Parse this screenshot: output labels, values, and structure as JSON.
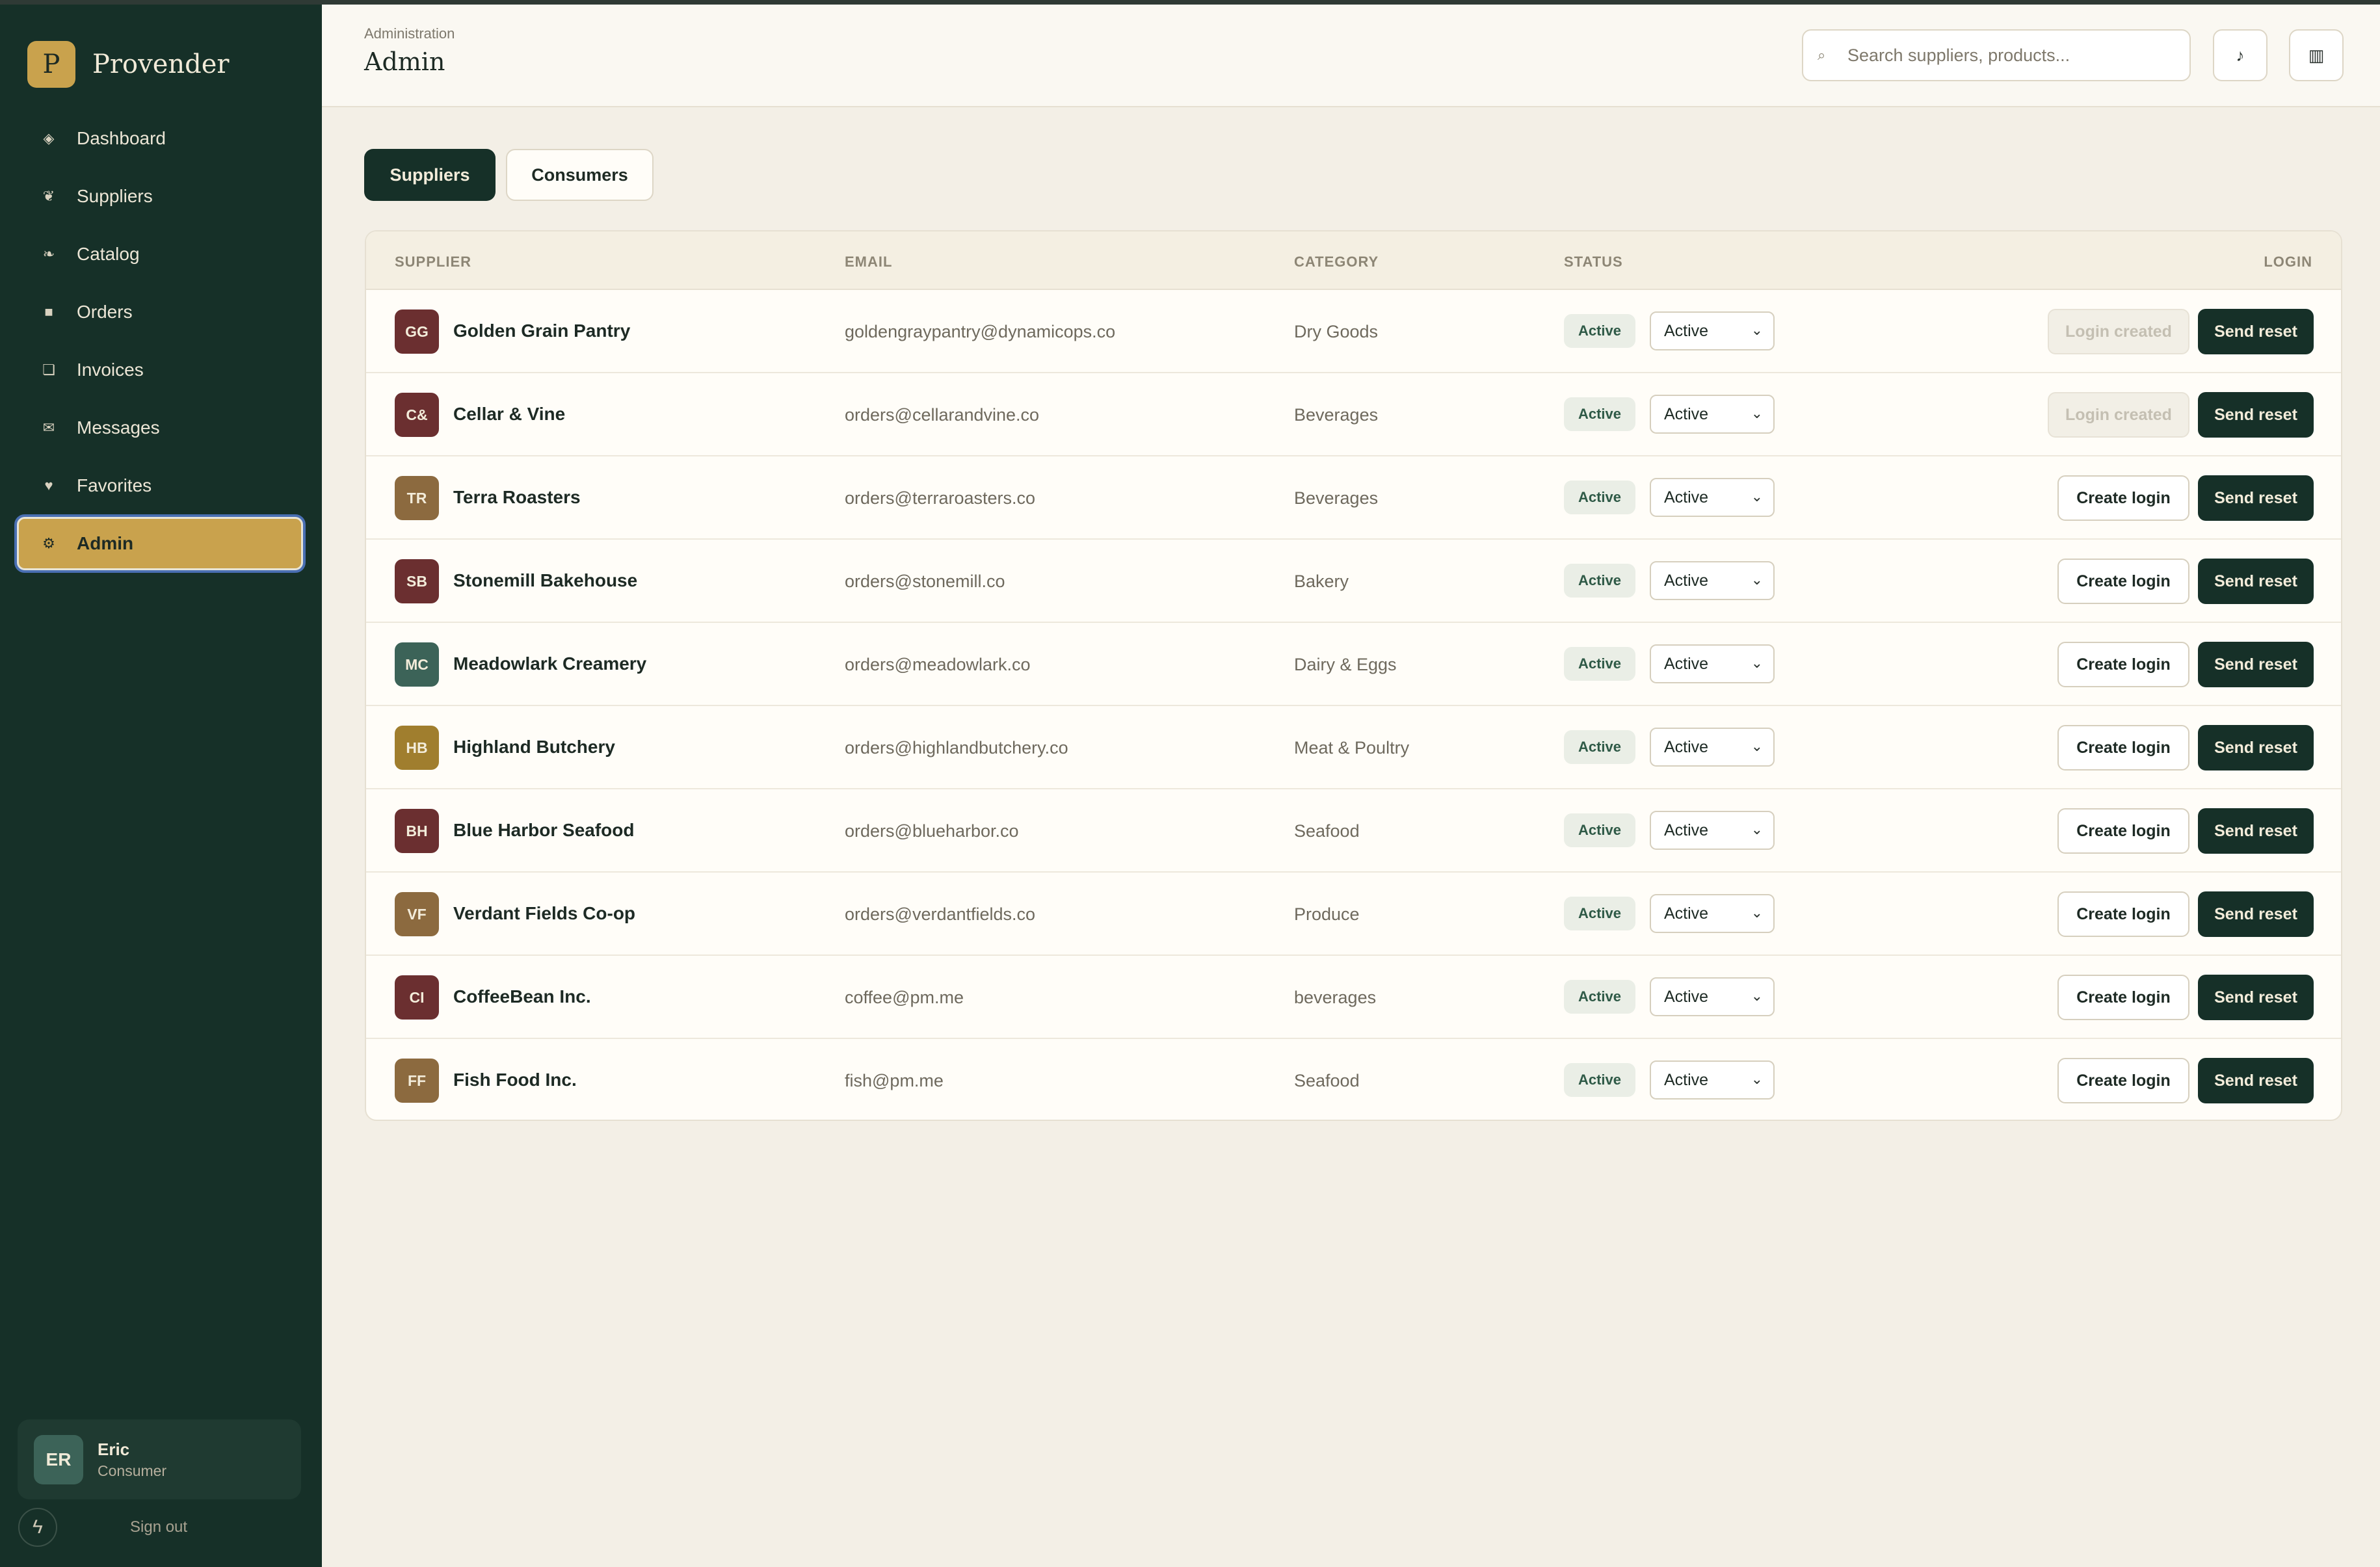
{
  "brand": {
    "mark": "P",
    "name": "Provender"
  },
  "sidebar": {
    "items": [
      {
        "label": "Dashboard",
        "icon": "◈",
        "icon_name": "dashboard-icon",
        "active": false
      },
      {
        "label": "Suppliers",
        "icon": "❦",
        "icon_name": "suppliers-icon",
        "active": false
      },
      {
        "label": "Catalog",
        "icon": "❧",
        "icon_name": "catalog-icon",
        "active": false
      },
      {
        "label": "Orders",
        "icon": "■",
        "icon_name": "orders-icon",
        "active": false
      },
      {
        "label": "Invoices",
        "icon": "❏",
        "icon_name": "invoices-icon",
        "active": false
      },
      {
        "label": "Messages",
        "icon": "✉",
        "icon_name": "messages-icon",
        "active": false
      },
      {
        "label": "Favorites",
        "icon": "♥",
        "icon_name": "favorites-icon",
        "active": false
      },
      {
        "label": "Admin",
        "icon": "⚙",
        "icon_name": "admin-icon",
        "active": true
      }
    ],
    "user": {
      "initials": "ER",
      "name": "Eric",
      "role": "Consumer"
    },
    "signout": "Sign out"
  },
  "header": {
    "breadcrumb": "Administration",
    "title": "Admin",
    "search_placeholder": "Search suppliers, products...",
    "icon_music": "♪",
    "icon_panel": "▥"
  },
  "tabs": [
    {
      "label": "Suppliers",
      "active": true
    },
    {
      "label": "Consumers",
      "active": false
    }
  ],
  "table": {
    "columns": {
      "supplier": "SUPPLIER",
      "email": "EMAIL",
      "category": "CATEGORY",
      "status": "STATUS",
      "login": "LOGIN"
    },
    "send_reset_label": "Send reset",
    "rows": [
      {
        "initials": "GG",
        "name": "Golden Grain Pantry",
        "email": "goldengraypantry@dynamicops.co",
        "category": "Dry Goods",
        "status": "Active",
        "status_select": "Active",
        "login": "Login created",
        "login_state": "created",
        "avatar_color": "#6b2f30"
      },
      {
        "initials": "C&",
        "name": "Cellar & Vine",
        "email": "orders@cellarandvine.co",
        "category": "Beverages",
        "status": "Active",
        "status_select": "Active",
        "login": "Login created",
        "login_state": "created",
        "avatar_color": "#6b2f30"
      },
      {
        "initials": "TR",
        "name": "Terra Roasters",
        "email": "orders@terraroasters.co",
        "category": "Beverages",
        "status": "Active",
        "status_select": "Active",
        "login": "Create login",
        "login_state": "create",
        "avatar_color": "#8c6a3f"
      },
      {
        "initials": "SB",
        "name": "Stonemill Bakehouse",
        "email": "orders@stonemill.co",
        "category": "Bakery",
        "status": "Active",
        "status_select": "Active",
        "login": "Create login",
        "login_state": "create",
        "avatar_color": "#6b2f30"
      },
      {
        "initials": "MC",
        "name": "Meadowlark Creamery",
        "email": "orders@meadowlark.co",
        "category": "Dairy & Eggs",
        "status": "Active",
        "status_select": "Active",
        "login": "Create login",
        "login_state": "create",
        "avatar_color": "#3c6358"
      },
      {
        "initials": "HB",
        "name": "Highland Butchery",
        "email": "orders@highlandbutchery.co",
        "category": "Meat & Poultry",
        "status": "Active",
        "status_select": "Active",
        "login": "Create login",
        "login_state": "create",
        "avatar_color": "#a07e2e"
      },
      {
        "initials": "BH",
        "name": "Blue Harbor Seafood",
        "email": "orders@blueharbor.co",
        "category": "Seafood",
        "status": "Active",
        "status_select": "Active",
        "login": "Create login",
        "login_state": "create",
        "avatar_color": "#6b2f30"
      },
      {
        "initials": "VF",
        "name": "Verdant Fields Co-op",
        "email": "orders@verdantfields.co",
        "category": "Produce",
        "status": "Active",
        "status_select": "Active",
        "login": "Create login",
        "login_state": "create",
        "avatar_color": "#8c6a3f"
      },
      {
        "initials": "CI",
        "name": "CoffeeBean Inc.",
        "email": "coffee@pm.me",
        "category": "beverages",
        "status": "Active",
        "status_select": "Active",
        "login": "Create login",
        "login_state": "create",
        "avatar_color": "#6b2f30"
      },
      {
        "initials": "FF",
        "name": "Fish Food Inc.",
        "email": "fish@pm.me",
        "category": "Seafood",
        "status": "Active",
        "status_select": "Active",
        "login": "Create login",
        "login_state": "create",
        "avatar_color": "#8c6a3f"
      }
    ]
  }
}
